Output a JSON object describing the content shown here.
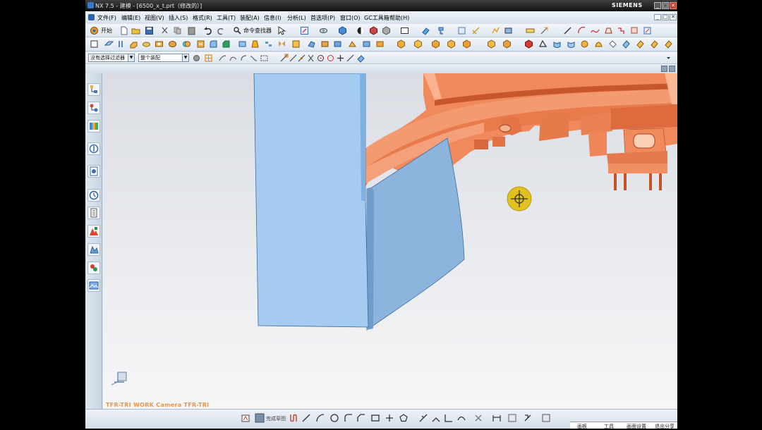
{
  "titlebar": {
    "title": "NX 7.5 - 建模 - [6500_x_t.prt（修改的）]",
    "brand": "SIEMENS",
    "controls": [
      "_",
      "□",
      "✕"
    ]
  },
  "menu": {
    "items": [
      "文件(F)",
      "编辑(E)",
      "视图(V)",
      "插入(S)",
      "格式(R)",
      "工具(T)",
      "装配(A)",
      "信息(I)",
      "分析(L)",
      "首选项(P)",
      "窗口(O)",
      "GC工具箱",
      "帮助(H)"
    ],
    "mdi_controls": [
      "_",
      "□",
      "✕"
    ]
  },
  "toolbar1": {
    "start_label": "开始",
    "command_finder_label": "命令查找器"
  },
  "toolbar3": {
    "filter_value": "没有选择过滤器",
    "scope_value": "整个装配"
  },
  "viewport": {
    "watermark": "TFR-TRI WORK Camera TFR-TRI"
  },
  "bottom": {
    "sketch_label": "完成草图"
  },
  "status": {
    "items": [
      "画板",
      "工具",
      "画面设置",
      "退出分享"
    ]
  },
  "colors": {
    "part_orange": "#f08454",
    "sheet_light_blue": "#a4cbf0",
    "sheet_dark_blue": "#8fb6de",
    "cursor_yellow": "#e5c21e"
  }
}
